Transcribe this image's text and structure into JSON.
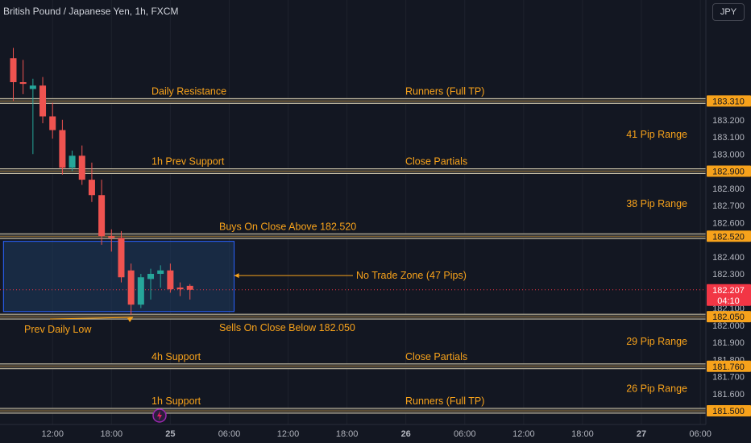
{
  "header": {
    "symbol": "British Pound / Japanese Yen, 1h, FXCM",
    "currency_button": "JPY"
  },
  "colors": {
    "background": "#131722",
    "bull": "#26a69a",
    "bear": "#ef5350",
    "level_line": "#c9c2a8",
    "annotation": "#f7a21b",
    "zone_fill": "#1e3a5f",
    "zone_border": "#2962ff",
    "price_tag": "#f7a21b",
    "last_price_tag": "#f23645",
    "axis_text": "#b2b5be",
    "grid": "#1e222d"
  },
  "chart_data": {
    "type": "candlestick",
    "title": "British Pound / Japanese Yen, 1h, FXCM",
    "ylim": [
      181.42,
      183.9
    ],
    "y_ticks": [
      "183.300",
      "183.200",
      "183.100",
      "183.000",
      "182.800",
      "182.700",
      "182.600",
      "182.400",
      "182.300",
      "182.200",
      "182.100",
      "182.000",
      "181.900",
      "181.800",
      "181.700",
      "181.600"
    ],
    "x_ticks": [
      {
        "hour": 12,
        "label": "12:00"
      },
      {
        "hour": 18,
        "label": "18:00"
      },
      {
        "hour": 24,
        "label": "25"
      },
      {
        "hour": 30,
        "label": "06:00"
      },
      {
        "hour": 36,
        "label": "12:00"
      },
      {
        "hour": 42,
        "label": "18:00"
      },
      {
        "hour": 48,
        "label": "26"
      },
      {
        "hour": 54,
        "label": "06:00"
      },
      {
        "hour": 60,
        "label": "12:00"
      },
      {
        "hour": 66,
        "label": "18:00"
      },
      {
        "hour": 72,
        "label": "27"
      },
      {
        "hour": 78,
        "label": "06:00"
      }
    ],
    "candles": [
      {
        "hour": 8,
        "open": 183.56,
        "high": 183.62,
        "low": 183.31,
        "close": 183.42
      },
      {
        "hour": 9,
        "open": 183.42,
        "high": 183.55,
        "low": 183.35,
        "close": 183.41
      },
      {
        "hour": 10,
        "open": 183.38,
        "high": 183.44,
        "low": 183.0,
        "close": 183.4
      },
      {
        "hour": 11,
        "open": 183.4,
        "high": 183.45,
        "low": 183.18,
        "close": 183.22
      },
      {
        "hour": 12,
        "open": 183.22,
        "high": 183.3,
        "low": 183.09,
        "close": 183.14
      },
      {
        "hour": 13,
        "open": 183.14,
        "high": 183.2,
        "low": 182.88,
        "close": 182.92
      },
      {
        "hour": 14,
        "open": 182.92,
        "high": 183.02,
        "low": 182.9,
        "close": 182.99
      },
      {
        "hour": 15,
        "open": 182.99,
        "high": 183.05,
        "low": 182.82,
        "close": 182.85
      },
      {
        "hour": 16,
        "open": 182.85,
        "high": 182.95,
        "low": 182.72,
        "close": 182.76
      },
      {
        "hour": 17,
        "open": 182.76,
        "high": 182.85,
        "low": 182.47,
        "close": 182.52
      },
      {
        "hour": 18,
        "open": 182.52,
        "high": 182.56,
        "low": 182.43,
        "close": 182.51
      },
      {
        "hour": 19,
        "open": 182.51,
        "high": 182.55,
        "low": 182.25,
        "close": 182.28
      },
      {
        "hour": 20,
        "open": 182.32,
        "high": 182.36,
        "low": 182.06,
        "close": 182.12
      },
      {
        "hour": 21,
        "open": 182.12,
        "high": 182.3,
        "low": 182.1,
        "close": 182.28
      },
      {
        "hour": 22,
        "open": 182.27,
        "high": 182.33,
        "low": 182.15,
        "close": 182.3
      },
      {
        "hour": 23,
        "open": 182.3,
        "high": 182.35,
        "low": 182.22,
        "close": 182.32
      },
      {
        "hour": 24,
        "open": 182.32,
        "high": 182.36,
        "low": 182.19,
        "close": 182.21
      },
      {
        "hour": 25,
        "open": 182.22,
        "high": 182.25,
        "low": 182.17,
        "close": 182.21
      },
      {
        "hour": 26,
        "open": 182.23,
        "high": 182.24,
        "low": 182.15,
        "close": 182.207
      }
    ],
    "levels": [
      {
        "price": 183.31,
        "tag": "183.310",
        "left_label": "Daily Resistance",
        "mid_label": "Runners (Full TP)"
      },
      {
        "price": 182.9,
        "tag": "182.900",
        "left_label": "1h Prev Support",
        "mid_label": "Close Partials"
      },
      {
        "price": 182.52,
        "tag": "182.520",
        "left_label": "Buys On Close Above 182.520",
        "mid_label": ""
      },
      {
        "price": 182.05,
        "tag": "182.050",
        "left_label": "Sells On Close Below 182.050",
        "mid_label": ""
      },
      {
        "price": 181.76,
        "tag": "181.760",
        "left_label": "4h Support",
        "mid_label": "Close Partials"
      },
      {
        "price": 181.5,
        "tag": "181.500",
        "left_label": "1h Support",
        "mid_label": "Runners (Full TP)"
      }
    ],
    "range_labels": [
      {
        "price": 183.115,
        "text": "41 Pip Range"
      },
      {
        "price": 182.71,
        "text": "38 Pip Range"
      },
      {
        "price": 181.905,
        "text": "29 Pip Range"
      },
      {
        "price": 181.63,
        "text": "26 Pip Range"
      }
    ],
    "no_trade_zone": {
      "from_hour": 7,
      "to_hour": 30.5,
      "top": 182.49,
      "bottom": 182.08,
      "label": "No Trade Zone (47 Pips)",
      "arrow_price": 182.29
    },
    "prev_daily_low": {
      "label": "Prev Daily Low",
      "price": 182.06,
      "hour": 20.2
    },
    "last_price": {
      "value": 182.207,
      "tag": "182.207",
      "countdown": "04:10"
    }
  }
}
